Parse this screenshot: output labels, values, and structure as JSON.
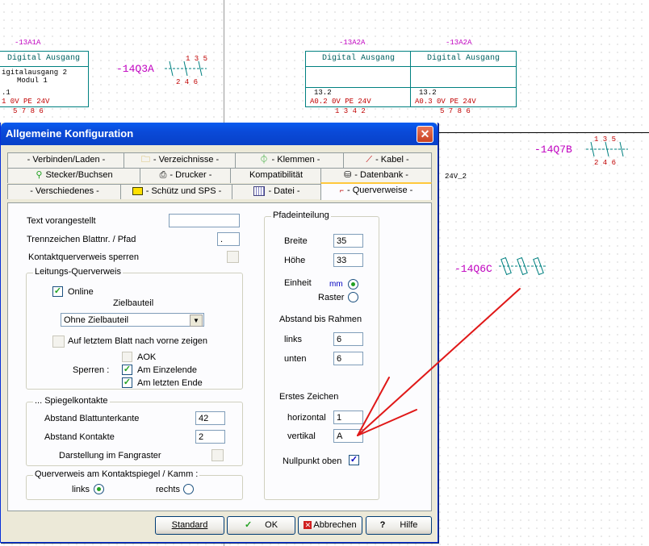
{
  "cad": {
    "addr_left": "-13A1A",
    "addr_mid": "-13A2A",
    "addr_right": "-13A2A",
    "box1": {
      "title": "Digital Ausgang",
      "line1": "igitalausgang 2",
      "line2": "Modul 1",
      "line3": ".1",
      "pins": "1  0V PE 24V",
      "pinnums": "5   7   8   6"
    },
    "box2": {
      "title": "Digital Ausgang",
      "line1": "13.2",
      "pins": "A0.2  0V PE 24V",
      "pinnums": "1   3   4   2"
    },
    "box3": {
      "title": "Digital Ausgang",
      "line1": "13.2",
      "pins": "A0.3  0V PE 24V",
      "pinnums": "5   7   8   6"
    },
    "tag1": "-14Q3A",
    "tag2": "-14Q7B",
    "tag3": "-14Q6C",
    "wire_label": "24V_2",
    "contact_nums": {
      "top": "1  3  5",
      "bottom": "2  4  6"
    }
  },
  "dialog": {
    "title": "Allgemeine Konfiguration",
    "close": "✕",
    "tabs_row1": [
      {
        "label": "- Verbinden/Laden -",
        "icon": ""
      },
      {
        "label": "- Verzeichnisse -",
        "icon": "folder-icon"
      },
      {
        "label": "- Klemmen -",
        "icon": "terminal-icon"
      },
      {
        "label": "- Kabel -",
        "icon": "cable-icon"
      }
    ],
    "tabs_row2": [
      {
        "label": "Stecker/Buchsen",
        "icon": "plug-icon"
      },
      {
        "label": "- Drucker -",
        "icon": "printer-icon"
      },
      {
        "label": "Kompatibilität",
        "icon": ""
      },
      {
        "label": "- Datenbank -",
        "icon": "database-icon"
      }
    ],
    "tabs_row3": [
      {
        "label": "- Verschiedenes -",
        "icon": ""
      },
      {
        "label": "- Schütz und SPS -",
        "icon": "relay-icon"
      },
      {
        "label": "- Datei -",
        "icon": "grid-icon"
      },
      {
        "label": "- Querverweise -",
        "icon": "crossref-icon",
        "active": true
      }
    ],
    "text_prefix_label": "Text vorangestellt",
    "text_prefix_value": "",
    "separator_label": "Trennzeichen Blattnr. / Pfad",
    "separator_value": ".",
    "contact_lock_label": "Kontaktquerverweis sperren",
    "line_group": {
      "title": "Leitungs-Querverweis",
      "online_label": "Online",
      "online_checked": true,
      "target_label": "Zielbauteil",
      "target_value": "Ohne Zielbauteil",
      "last_sheet_label": "Auf letztem Blatt nach vorne zeigen",
      "lock_label": "Sperren :",
      "aok_label": "AOK",
      "single_label": "Am Einzelende",
      "last_end_label": "Am letzten Ende"
    },
    "mirror_group": {
      "title": "... Spiegelkontakte",
      "bottom_dist_label": "Abstand Blattunterkante",
      "bottom_dist_value": "42",
      "contact_dist_label": "Abstand Kontakte",
      "contact_dist_value": "2",
      "catch_grid_label": "Darstellung im Fangraster"
    },
    "comb_group": {
      "title": "Querverweis am Kontaktspiegel / Kamm :",
      "left_label": "links",
      "right_label": "rechts"
    },
    "path_group": {
      "title": "Pfadeinteilung",
      "width_label": "Breite",
      "width_value": "35",
      "height_label": "Höhe",
      "height_value": "33",
      "unit_label": "Einheit",
      "mm_label": "mm",
      "grid_label": "Raster",
      "frame_label": "Abstand bis Rahmen",
      "left_label": "links",
      "left_value": "6",
      "bottom_label": "unten",
      "bottom_value": "6",
      "first_char_label": "Erstes Zeichen",
      "horizontal_label": "horizontal",
      "horizontal_value": "1",
      "vertical_label": "vertikal",
      "vertical_value": "A",
      "origin_label": "Nullpunkt oben"
    },
    "buttons": {
      "standard": "Standard",
      "ok": "OK",
      "cancel": "Abbrechen",
      "help": "Hilfe"
    }
  },
  "colors": {
    "accent": "#0a4ad8",
    "annotation": "#e01818",
    "cad_tag": "#c000c0",
    "cad_box": "#008080"
  }
}
